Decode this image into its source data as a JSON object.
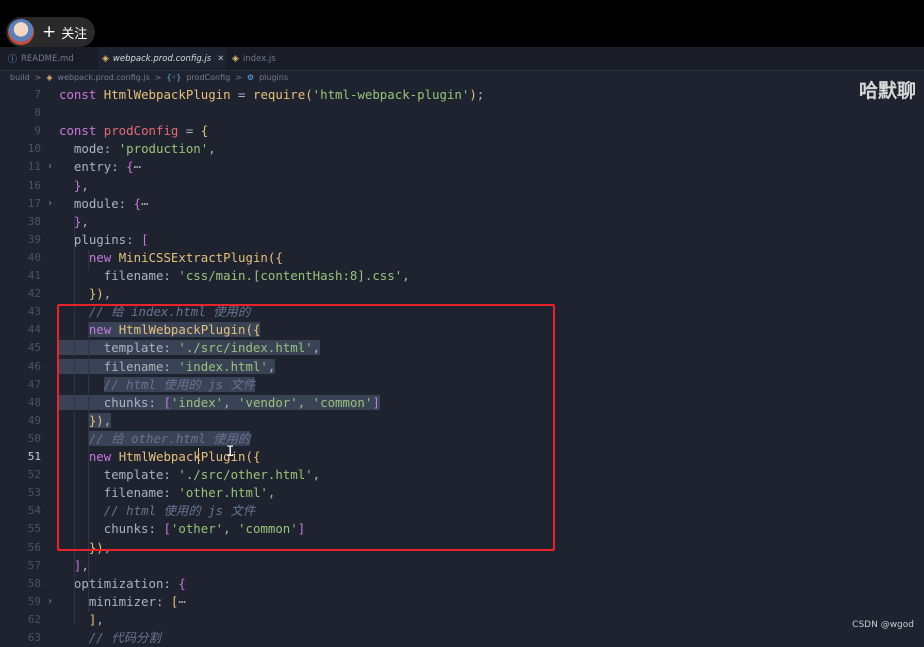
{
  "profile": {
    "follow_plus": "+",
    "follow_label": "关注"
  },
  "tabs": [
    {
      "icon": "info-icon",
      "label": "README.md",
      "active": false
    },
    {
      "icon": "js-file-icon",
      "label": "webpack.prod.config.js",
      "active": true,
      "close": "✕"
    },
    {
      "icon": "js-file-icon",
      "label": "index.js",
      "active": false
    }
  ],
  "breadcrumb": {
    "items": [
      "build",
      "webpack.prod.config.js",
      "prodConfig",
      "plugins"
    ],
    "sep": ">"
  },
  "watermark": "哈默聊",
  "credit": "CSDN @wgod",
  "current_line": "51",
  "lines": [
    {
      "n": "7",
      "tokens": [
        [
          "kw",
          "const "
        ],
        [
          "fn",
          "HtmlWebpackPlugin"
        ],
        [
          "pl",
          " = "
        ],
        [
          "fn",
          "require"
        ],
        [
          "p1",
          "("
        ],
        [
          "st",
          "'html-webpack-plugin'"
        ],
        [
          "p1",
          ")"
        ],
        [
          "pl",
          ";"
        ]
      ]
    },
    {
      "n": "8",
      "tokens": []
    },
    {
      "n": "9",
      "tokens": [
        [
          "kw",
          "const "
        ],
        [
          "pr",
          "prodConfig"
        ],
        [
          "pl",
          " = "
        ],
        [
          "p1",
          "{"
        ]
      ]
    },
    {
      "n": "10",
      "tokens": [
        [
          "pl",
          "  mode: "
        ],
        [
          "st",
          "'production'"
        ],
        [
          "pl",
          ","
        ]
      ]
    },
    {
      "n": "11",
      "fold": "›",
      "tokens": [
        [
          "pl",
          "  entry: "
        ],
        [
          "p2",
          "{"
        ],
        [
          "pl",
          "⋯"
        ]
      ]
    },
    {
      "n": "16",
      "tokens": [
        [
          "pl",
          "  "
        ],
        [
          "p2",
          "}"
        ],
        [
          "pl",
          ","
        ]
      ]
    },
    {
      "n": "17",
      "fold": "›",
      "tokens": [
        [
          "pl",
          "  module: "
        ],
        [
          "p2",
          "{"
        ],
        [
          "pl",
          "⋯"
        ]
      ]
    },
    {
      "n": "38",
      "tokens": [
        [
          "pl",
          "  "
        ],
        [
          "p2",
          "}"
        ],
        [
          "pl",
          ","
        ]
      ]
    },
    {
      "n": "39",
      "tokens": [
        [
          "pl",
          "  plugins: "
        ],
        [
          "p2",
          "["
        ]
      ]
    },
    {
      "n": "40",
      "tokens": [
        [
          "pl",
          "    "
        ],
        [
          "kw",
          "new "
        ],
        [
          "fn",
          "MiniCSSExtractPlugin"
        ],
        [
          "p1",
          "({"
        ]
      ]
    },
    {
      "n": "41",
      "tokens": [
        [
          "pl",
          "      filename: "
        ],
        [
          "st",
          "'css/main.[contentHash:8].css'"
        ],
        [
          "pl",
          ","
        ]
      ]
    },
    {
      "n": "42",
      "tokens": [
        [
          "pl",
          "    "
        ],
        [
          "p1",
          "})"
        ],
        [
          "pl",
          ","
        ]
      ]
    },
    {
      "n": "43",
      "tokens": [
        [
          "pl",
          "    "
        ],
        [
          "cm",
          "// 给 index.html 使用的"
        ]
      ]
    },
    {
      "n": "44",
      "tokens": [
        [
          "pl",
          "    "
        ],
        [
          "kw",
          "new "
        ],
        [
          "fn",
          "HtmlWebpackPlugin"
        ],
        [
          "p1",
          "({"
        ]
      ]
    },
    {
      "n": "45",
      "tokens": [
        [
          "pl",
          "      template: "
        ],
        [
          "st",
          "'./src/index.html'"
        ],
        [
          "pl",
          ","
        ]
      ]
    },
    {
      "n": "46",
      "tokens": [
        [
          "pl",
          "      filename: "
        ],
        [
          "st",
          "'index.html'"
        ],
        [
          "pl",
          ","
        ]
      ]
    },
    {
      "n": "47",
      "tokens": [
        [
          "pl",
          "      "
        ],
        [
          "cm",
          "// html 使用的 js 文件"
        ]
      ]
    },
    {
      "n": "48",
      "tokens": [
        [
          "pl",
          "      chunks: "
        ],
        [
          "p2",
          "["
        ],
        [
          "st",
          "'index'"
        ],
        [
          "pl",
          ", "
        ],
        [
          "st",
          "'vendor'"
        ],
        [
          "pl",
          ", "
        ],
        [
          "st",
          "'common'"
        ],
        [
          "p2",
          "]"
        ]
      ]
    },
    {
      "n": "49",
      "tokens": [
        [
          "pl",
          "    "
        ],
        [
          "p1",
          "})"
        ],
        [
          "pl",
          ","
        ]
      ]
    },
    {
      "n": "50",
      "tokens": [
        [
          "pl",
          "    "
        ],
        [
          "cm",
          "// 给 other.html 使用的"
        ]
      ]
    },
    {
      "n": "51",
      "tokens": [
        [
          "pl",
          "    "
        ],
        [
          "kw",
          "new "
        ],
        [
          "fn",
          "HtmlWebpackPlugin"
        ],
        [
          "p1",
          "({"
        ]
      ]
    },
    {
      "n": "52",
      "tokens": [
        [
          "pl",
          "      template: "
        ],
        [
          "st",
          "'./src/other.html'"
        ],
        [
          "pl",
          ","
        ]
      ]
    },
    {
      "n": "53",
      "tokens": [
        [
          "pl",
          "      filename: "
        ],
        [
          "st",
          "'other.html'"
        ],
        [
          "pl",
          ","
        ]
      ]
    },
    {
      "n": "54",
      "tokens": [
        [
          "pl",
          "      "
        ],
        [
          "cm",
          "// html 使用的 js 文件"
        ]
      ]
    },
    {
      "n": "55",
      "tokens": [
        [
          "pl",
          "      chunks: "
        ],
        [
          "p2",
          "["
        ],
        [
          "st",
          "'other'"
        ],
        [
          "pl",
          ", "
        ],
        [
          "st",
          "'common'"
        ],
        [
          "p2",
          "]"
        ]
      ]
    },
    {
      "n": "56",
      "tokens": [
        [
          "pl",
          "    "
        ],
        [
          "p1",
          "})"
        ],
        [
          "pl",
          ","
        ]
      ]
    },
    {
      "n": "57",
      "tokens": [
        [
          "pl",
          "  "
        ],
        [
          "p2",
          "]"
        ],
        [
          "pl",
          ","
        ]
      ]
    },
    {
      "n": "58",
      "tokens": [
        [
          "pl",
          "  optimization: "
        ],
        [
          "p2",
          "{"
        ]
      ]
    },
    {
      "n": "59",
      "fold": "›",
      "tokens": [
        [
          "pl",
          "    minimizer: "
        ],
        [
          "p1",
          "["
        ],
        [
          "pl",
          "⋯"
        ]
      ]
    },
    {
      "n": "62",
      "tokens": [
        [
          "pl",
          "    "
        ],
        [
          "p1",
          "]"
        ],
        [
          "pl",
          ","
        ]
      ]
    },
    {
      "n": "63",
      "tokens": [
        [
          "pl",
          "    "
        ],
        [
          "cm",
          "// 代码分割"
        ]
      ]
    }
  ],
  "selected_lines": [
    "44",
    "45",
    "46",
    "47",
    "48",
    "49",
    "50"
  ]
}
